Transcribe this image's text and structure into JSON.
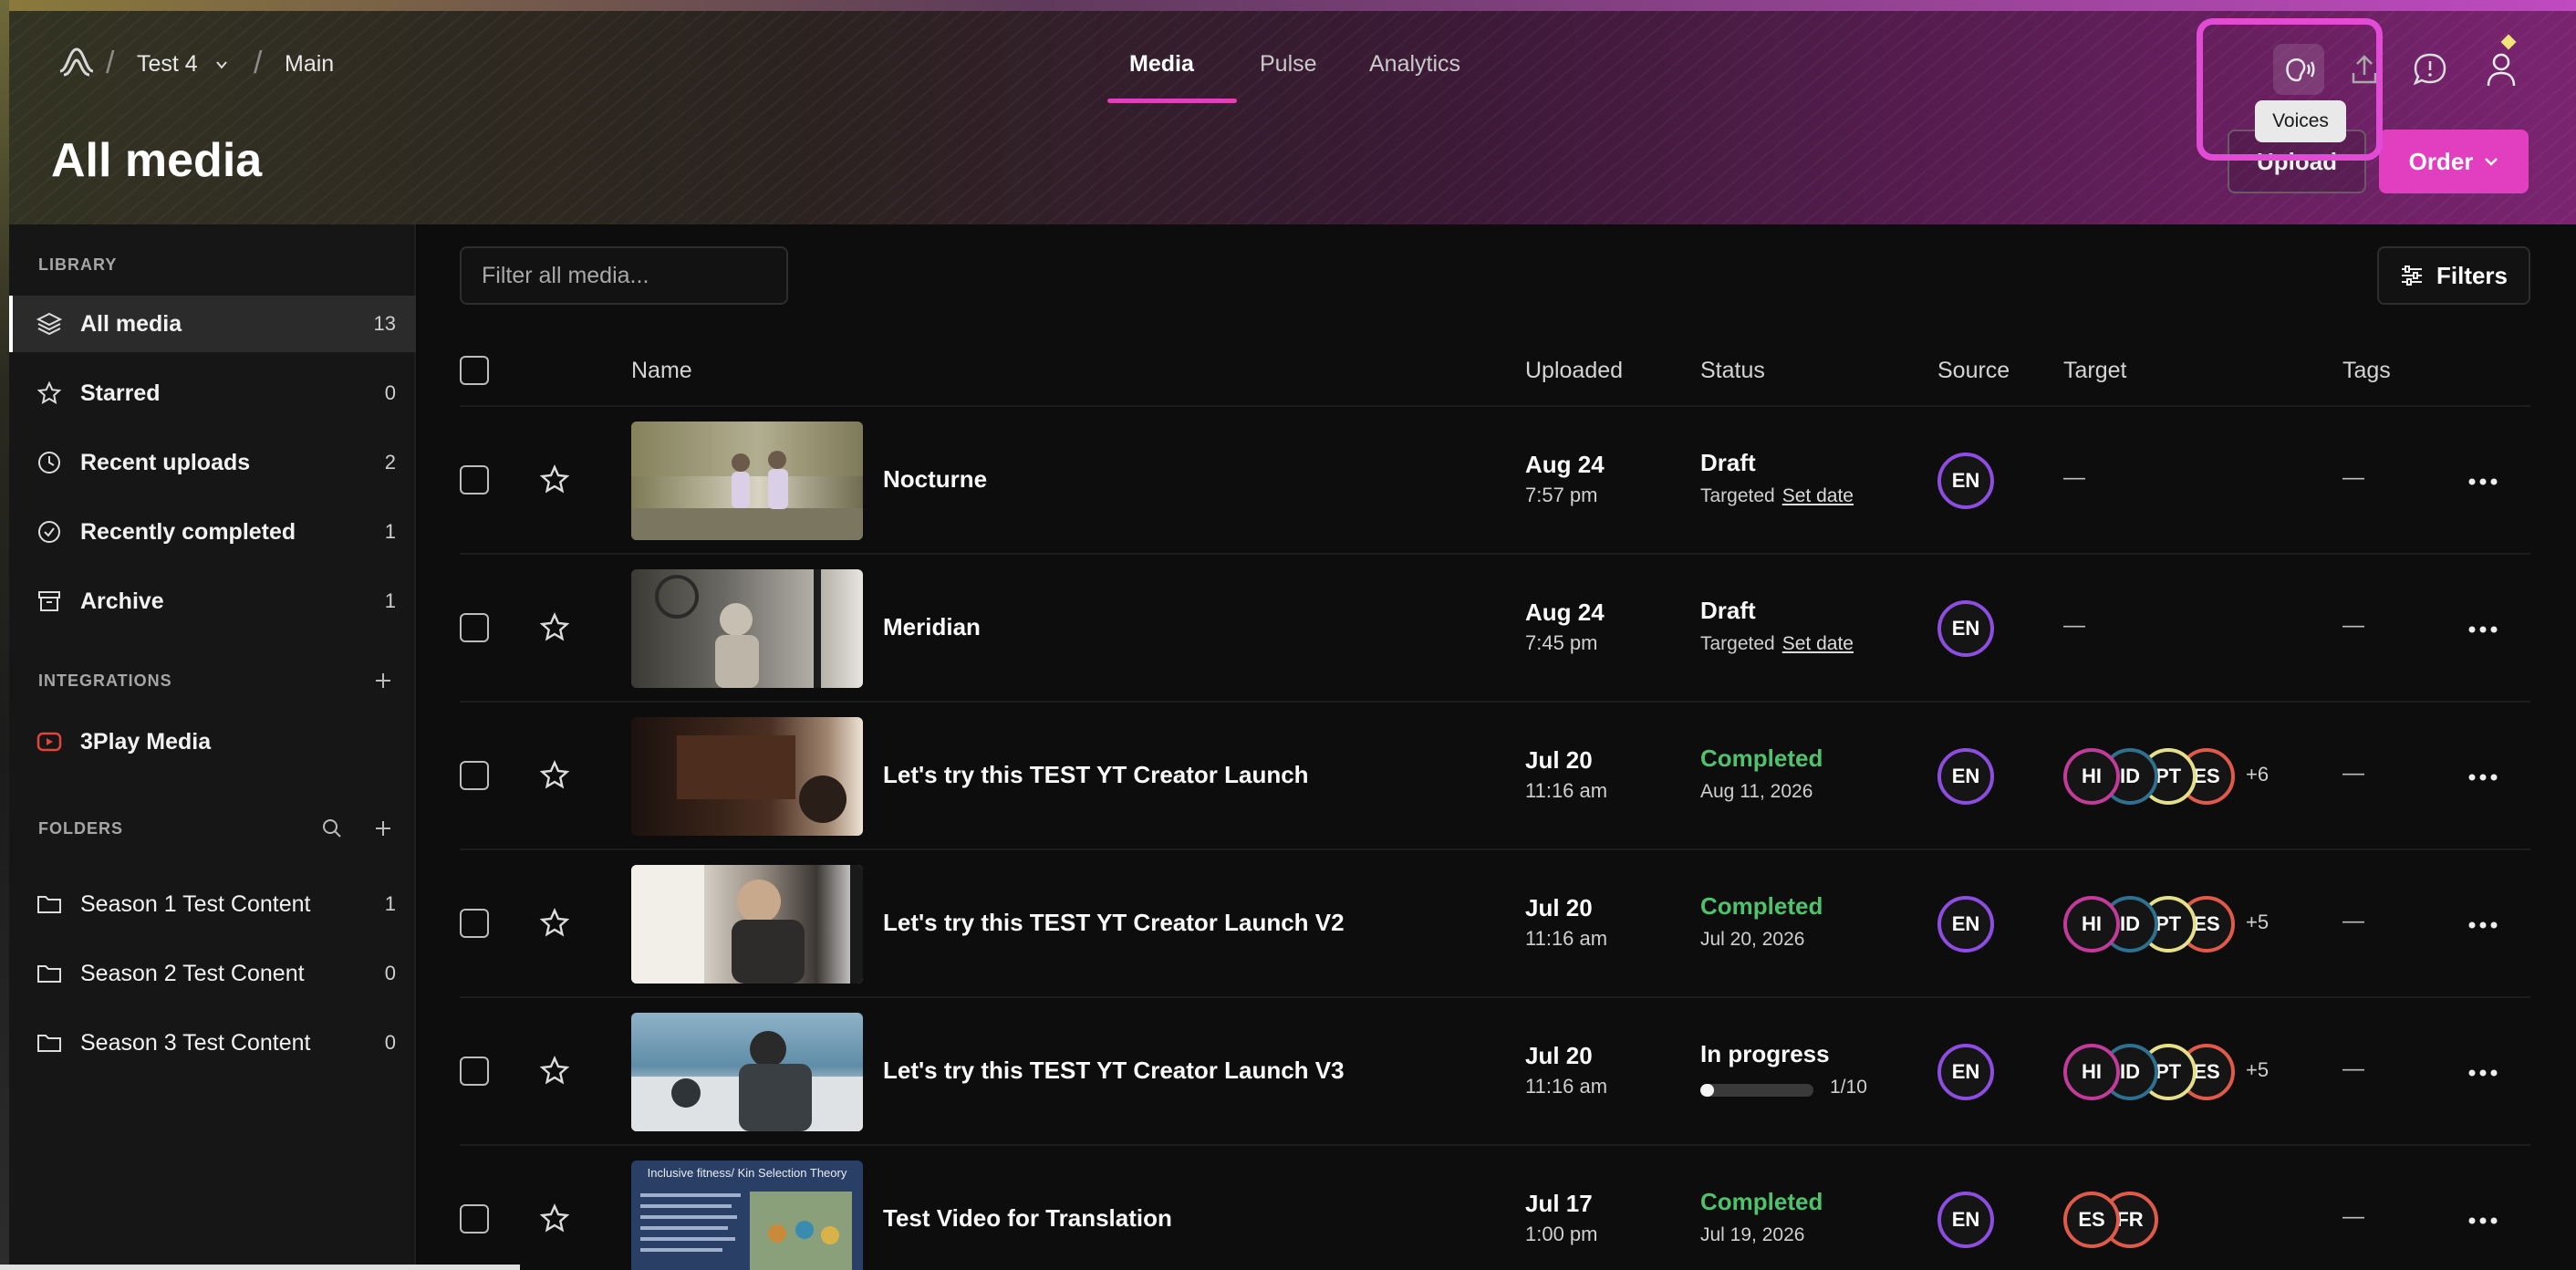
{
  "header": {
    "workspace": "Test 4",
    "project": "Main",
    "tabs": [
      "Media",
      "Pulse",
      "Analytics"
    ],
    "active_tab": "Media",
    "tooltip": "Voices",
    "icons": [
      "voices-icon",
      "upload-icon",
      "chat-icon",
      "profile-icon"
    ],
    "accent": "#e23fc0"
  },
  "page": {
    "title": "All media",
    "upload_label": "Upload",
    "order_label": "Order"
  },
  "sidebar": {
    "library_label": "LIBRARY",
    "library": [
      {
        "label": "All media",
        "count": "13",
        "icon": "layers-icon"
      },
      {
        "label": "Starred",
        "count": "0",
        "icon": "star-icon"
      },
      {
        "label": "Recent uploads",
        "count": "2",
        "icon": "clock-icon"
      },
      {
        "label": "Recently completed",
        "count": "1",
        "icon": "check-circle-icon"
      },
      {
        "label": "Archive",
        "count": "1",
        "icon": "archive-icon"
      }
    ],
    "integrations_label": "INTEGRATIONS",
    "integrations": [
      {
        "label": "3Play Media",
        "icon": "youtube-icon"
      }
    ],
    "folders_label": "FOLDERS",
    "folders": [
      {
        "label": "Season 1 Test Content",
        "count": "1"
      },
      {
        "label": "Season 2 Test Conent",
        "count": "0"
      },
      {
        "label": "Season 3 Test Content",
        "count": "0"
      }
    ]
  },
  "toolbar": {
    "filter_placeholder": "Filter all media...",
    "filters_label": "Filters"
  },
  "table": {
    "columns": [
      "Name",
      "Uploaded",
      "Status",
      "Source",
      "Target",
      "Tags"
    ],
    "rows": [
      {
        "name": "Nocturne",
        "date": "Aug 24",
        "time": "7:57 pm",
        "status": "Draft",
        "status_sub": "Targeted",
        "set_date": "Set date",
        "source": "EN",
        "targets": [],
        "target_empty": "—",
        "tags": "—"
      },
      {
        "name": "Meridian",
        "date": "Aug 24",
        "time": "7:45 pm",
        "status": "Draft",
        "status_sub": "Targeted",
        "set_date": "Set date",
        "source": "EN",
        "targets": [],
        "target_empty": "—",
        "tags": "—"
      },
      {
        "name": "Let's try this TEST YT Creator Launch",
        "date": "Jul 20",
        "time": "11:16 am",
        "status": "Completed",
        "status_sub": "Aug 11, 2026",
        "source": "EN",
        "targets": [
          "HI",
          "ID",
          "PT",
          "ES"
        ],
        "target_more": "+6",
        "tags": "—"
      },
      {
        "name": "Let's try this TEST YT Creator Launch V2",
        "date": "Jul 20",
        "time": "11:16 am",
        "status": "Completed",
        "status_sub": "Jul 20, 2026",
        "source": "EN",
        "targets": [
          "HI",
          "ID",
          "PT",
          "ES"
        ],
        "target_more": "+5",
        "tags": "—"
      },
      {
        "name": "Let's try this TEST YT Creator Launch V3",
        "date": "Jul 20",
        "time": "11:16 am",
        "status": "In progress",
        "progress_text": "1/10",
        "progress": 0.1,
        "source": "EN",
        "targets": [
          "HI",
          "ID",
          "PT",
          "ES"
        ],
        "target_more": "+5",
        "tags": "—"
      },
      {
        "name": "Test Video for Translation",
        "date": "Jul 17",
        "time": "1:00 pm",
        "status": "Completed",
        "status_sub": "Jul 19, 2026",
        "source": "EN",
        "targets": [
          "ES",
          "FR"
        ],
        "tags": "—"
      }
    ],
    "thumb_text": "Inclusive fitness/ Kin Selection Theory"
  },
  "lang_colors": {
    "EN": "#8c4de0",
    "HI": "#c23a9a",
    "ID": "#2f6f8f",
    "PT": "#e6e08a",
    "ES": "#e05a4a",
    "FR": "#e05a4a"
  }
}
